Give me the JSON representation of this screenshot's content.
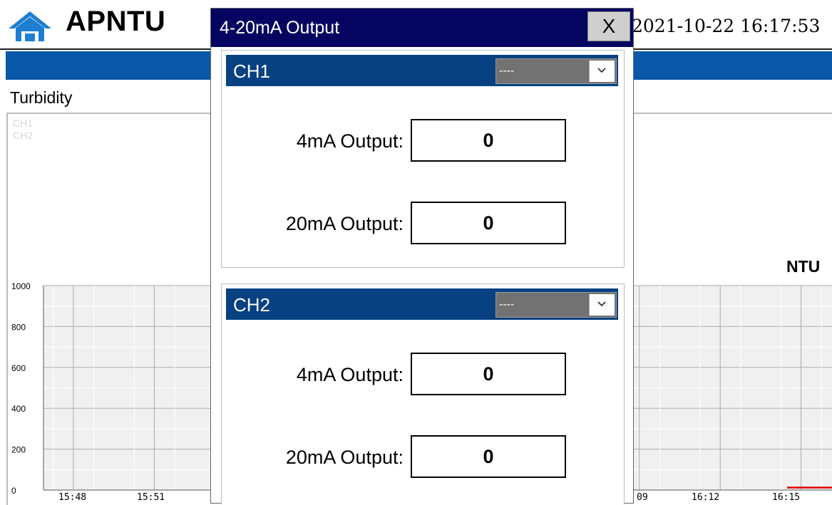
{
  "header": {
    "app_title": "APNTU",
    "datetime": "2021-10-22 16:17:53",
    "home_icon": "home-icon"
  },
  "main": {
    "section_title": "Turbidity",
    "unit": "NTU",
    "legend": [
      "CH1",
      "CH2"
    ]
  },
  "chart_data": {
    "type": "line",
    "y_ticks": [
      "1000",
      "800",
      "600",
      "400",
      "200",
      "0"
    ],
    "ylim": [
      0,
      1000
    ],
    "x_tick_labels_visible_left": [
      "15:48",
      "15:51"
    ],
    "x_tick_labels_visible_right": [
      "09",
      "16:12",
      "16:15"
    ],
    "series": [
      {
        "name": "CH1",
        "color": "#d8d8d8",
        "values": []
      },
      {
        "name": "CH2",
        "color": "#d8d8d8",
        "values": []
      }
    ],
    "red_trace_color": "#e00000",
    "grid": true
  },
  "dialog": {
    "title": "4-20mA Output",
    "close_label": "X",
    "channels": [
      {
        "label": "CH1",
        "select_value": "----",
        "out4_label": "4mA Output:",
        "out4_value": "0",
        "out20_label": "20mA Output:",
        "out20_value": "0"
      },
      {
        "label": "CH2",
        "select_value": "----",
        "out4_label": "4mA Output:",
        "out4_value": "0",
        "out20_label": "20mA Output:",
        "out20_value": "0"
      }
    ]
  },
  "colors": {
    "title_bar": "#050561",
    "channel_header": "#074182",
    "blue_band": "#0a58a8",
    "trace": "#e00000"
  }
}
